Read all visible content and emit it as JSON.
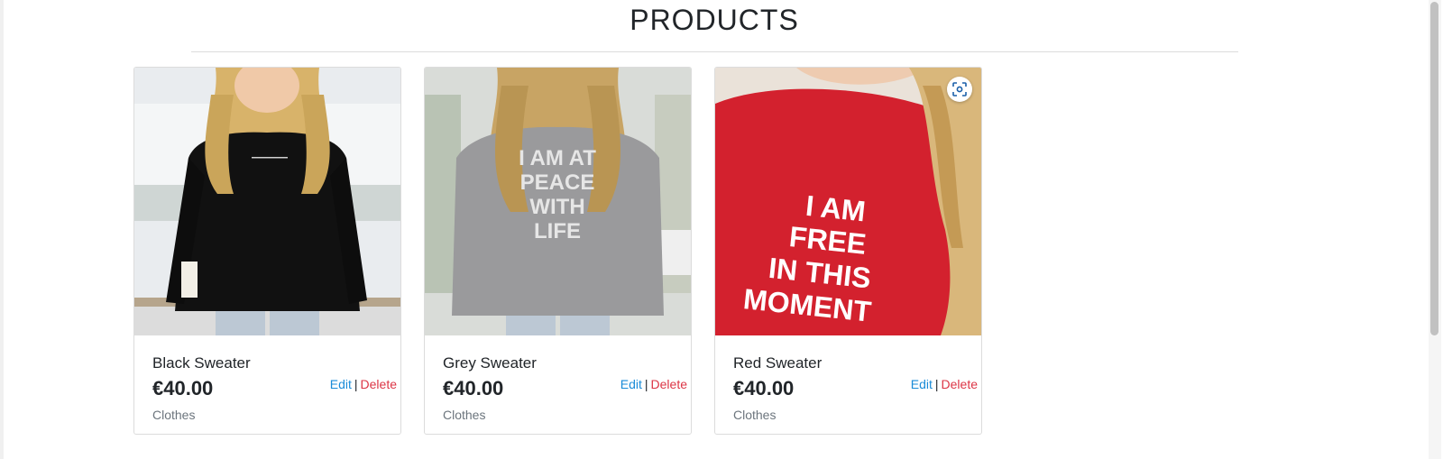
{
  "page": {
    "title": "PRODUCTS"
  },
  "products": [
    {
      "name": "Black Sweater",
      "price": "€40.00",
      "category": "Clothes",
      "edit_label": "Edit",
      "separator": "|",
      "delete_label": "Delete",
      "shirt_color": "#111111"
    },
    {
      "name": "Grey Sweater",
      "price": "€40.00",
      "category": "Clothes",
      "edit_label": "Edit",
      "separator": "|",
      "delete_label": "Delete",
      "shirt_color": "#9a9a9c",
      "print_lines": [
        "I AM AT",
        "PEACE",
        "WITH",
        "LIFE"
      ]
    },
    {
      "name": "Red Sweater",
      "price": "€40.00",
      "category": "Clothes",
      "edit_label": "Edit",
      "separator": "|",
      "delete_label": "Delete",
      "shirt_color": "#d3212e",
      "print_lines": [
        "I AM",
        "FREE",
        "IN THIS",
        "MOMENT"
      ]
    }
  ],
  "colors": {
    "edit": "#1a8cd8",
    "delete": "#dc3545"
  },
  "icons": {
    "image_search": "visual-search-icon"
  }
}
